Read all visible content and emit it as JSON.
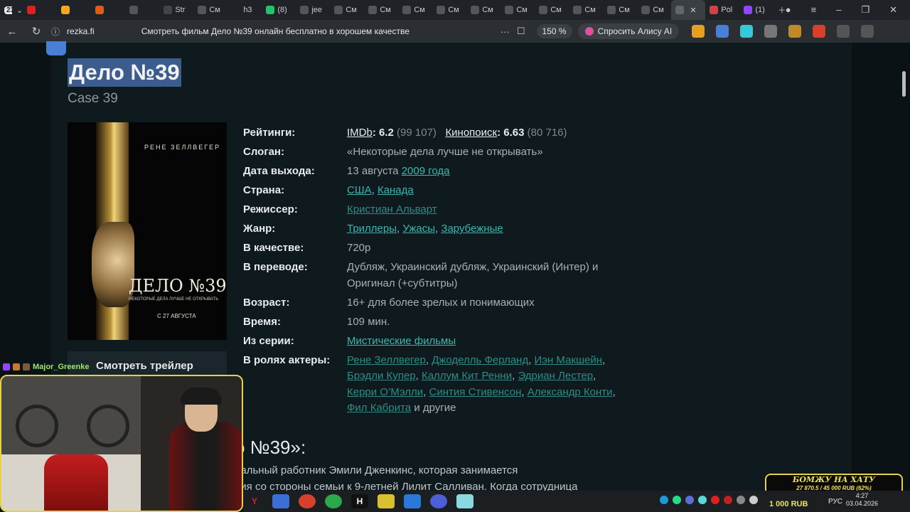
{
  "browser": {
    "tab_count": "23",
    "tabs": [
      {
        "label": "",
        "color": "#e02020"
      },
      {
        "label": "",
        "color": "#f5a623"
      },
      {
        "label": "",
        "color": "#e05a1c"
      },
      {
        "label": "",
        "color": "#555"
      },
      {
        "label": "Str",
        "color": "#444"
      },
      {
        "label": "См",
        "color": "#555"
      },
      {
        "label": "h3",
        "color": "#222"
      },
      {
        "label": "(8)",
        "color": "#25c26b"
      },
      {
        "label": "jee",
        "color": "#555"
      },
      {
        "label": "См",
        "color": "#555"
      },
      {
        "label": "См",
        "color": "#555"
      },
      {
        "label": "См",
        "color": "#555"
      },
      {
        "label": "См",
        "color": "#555"
      },
      {
        "label": "См",
        "color": "#555"
      },
      {
        "label": "См",
        "color": "#555"
      },
      {
        "label": "См",
        "color": "#555"
      },
      {
        "label": "См",
        "color": "#555"
      },
      {
        "label": "См",
        "color": "#555"
      },
      {
        "label": "См",
        "color": "#555"
      },
      {
        "label": "",
        "color": "#666",
        "active": true
      },
      {
        "label": "Pol",
        "color": "#c44"
      },
      {
        "label": "(1)",
        "color": "#9146ff"
      }
    ],
    "host": "rezka.fi",
    "page_title": "Смотреть фильм Дело №39 онлайн бесплатно в хорошем качестве",
    "zoom": "150 %",
    "alice_label": "Спросить Алису AI"
  },
  "movie": {
    "title": "Дело №39",
    "original_title": "Case 39",
    "poster": {
      "actor": "РЕНЕ ЗЕЛЛВЕГЕР",
      "title": "ДЕЛО №39",
      "tagline": "НЕКОТОРЫЕ ДЕЛА ЛУЧШЕ НЕ ОТКРЫВАТЬ",
      "date": "С 27 АВГУСТА"
    },
    "trailer_label": "Смотреть трейлер",
    "ratings_label": "Рейтинги:",
    "imdb_label": "IMDb",
    "imdb_score": "6.2",
    "imdb_votes": "(99 107)",
    "kp_label": "Кинопоиск",
    "kp_score": "6.63",
    "kp_votes": "(80 716)",
    "slogan_label": "Слоган:",
    "slogan": "«Некоторые дела лучше не открывать»",
    "release_label": "Дата выхода:",
    "release_day": "13 августа",
    "release_year": "2009 года",
    "country_label": "Страна:",
    "country_1": "США",
    "country_2": "Канада",
    "director_label": "Режиссер:",
    "director": "Кристиан Альварт",
    "genre_label": "Жанр:",
    "genre_1": "Триллеры",
    "genre_2": "Ужасы",
    "genre_3": "Зарубежные",
    "quality_label": "В качестве:",
    "quality": "720p",
    "translation_label": "В переводе:",
    "translation": "Дубляж, Украинский дубляж, Украинский (Интер) и Оригинал (+субтитры)",
    "age_label": "Возраст:",
    "age": "16+ для более зрелых и понимающих",
    "time_label": "Время:",
    "time": "109 мин.",
    "series_label": "Из серии:",
    "series": "Мистические фильмы",
    "actors_label": "В ролях актеры:",
    "actors": [
      "Рене Зеллвегер",
      "Джоделль Ферланд",
      "Иэн Макшейн",
      "Брэдли Купер",
      "Каллум Кит Ренни",
      "Эдриан Лестер",
      "Керри О’Мэлли",
      "Синтия Стивенсон",
      "Александр Конти",
      "Фил Кабрита"
    ],
    "actors_more": "и другие",
    "about_heading": "о №39»:",
    "desc_line1": "иальный работник Эмили Дженкинс, которая занимается",
    "desc_line2": "ния со стороны семьи к 9-летней Лилит Салливан. Когда сотрудница"
  },
  "stream": {
    "chat_user": "Major_Greenke",
    "donate_title": "БОМЖУ НА ХАТУ",
    "donate_progress": "27 870.5 / 45 000 RUB (62%)",
    "donate_amount": "1 000 RUB"
  },
  "taskbar": {
    "lang": "РУС",
    "time": "4:27",
    "date": "03.04.2026"
  }
}
